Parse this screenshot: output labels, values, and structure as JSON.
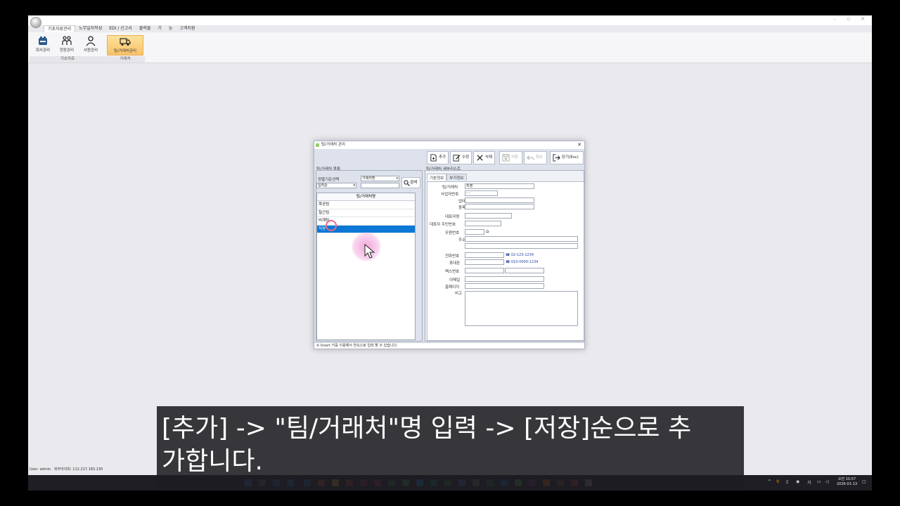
{
  "app": {
    "menu_tabs": [
      "기초자료관리",
      "노무일지작성",
      "EDI / 신고서",
      "출력물",
      "기",
      "능",
      "고객지원"
    ],
    "ribbon_buttons": [
      {
        "label": "회사관리",
        "icon": "company-icon"
      },
      {
        "label": "현장관리",
        "icon": "site-icon"
      },
      {
        "label": "사원관리",
        "icon": "employee-icon"
      },
      {
        "label": "팀/거래처관리",
        "icon": "truck-icon"
      }
    ],
    "ribbon_groups": [
      "기초자료",
      "거래처"
    ],
    "status_user": "User: admin",
    "status_ip": "외부아이피: 112.217.183.130"
  },
  "dialog": {
    "title": "팀/거래처 관리",
    "toolbar": {
      "add": "추가",
      "edit": "수정",
      "delete": "삭제",
      "save": "저장",
      "cancel": "취소",
      "close": "닫기(Esc)"
    },
    "list_panel": {
      "legend": "팀/거래처 목록",
      "sort_label": "정렬기준선택",
      "sort_value": "입력순",
      "search_field_value": "거래처명",
      "search_text": "",
      "search_button": "검색",
      "column_header": "팀/거래처명",
      "rows": [
        "목공팀",
        "철근팀",
        "비계팀",
        "직영"
      ],
      "selected_index": 3
    },
    "detail_panel": {
      "legend": "팀/거래처 세부리스트",
      "tabs": [
        "기본정보",
        "부가정보"
      ],
      "fields": {
        "name_label": "팀/거래처",
        "name_value": "직영",
        "bizno_label": "사업자번호",
        "bizno_value": "  -   -",
        "biztype_label": "업태",
        "bizitem_label": "종목",
        "ceo_label": "대표자명",
        "ceo_id_label": "대표자 주민번호",
        "zip_label": "우편번호",
        "addr_label": "주소",
        "tel_label": "전화번호",
        "tel_hint": "02-123-1234",
        "mobile_label": "휴대폰",
        "mobile_hint": "010-0000-1234",
        "fax_label": "팩스번호",
        "email_label": "이메일",
        "homepage_label": "홈페이지",
        "memo_label": "비고"
      }
    },
    "status": "※ Insert 키를 이용해서 연속으로 입력 할 수 있습니다."
  },
  "taskbar": {
    "time": "오전 10:57",
    "date": "2026-01-13",
    "ime": "가"
  },
  "subtitle": {
    "line1": "[추가] -> \"팀/거래처\"명 입력 -> [저장]순으로 추",
    "line2": "가합니다."
  }
}
